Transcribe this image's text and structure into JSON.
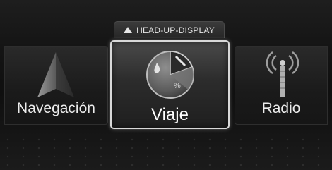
{
  "hud": {
    "label": "HEAD-UP-DISPLAY",
    "icon": "triangle-up-icon"
  },
  "menu": {
    "items": [
      {
        "label": "Navegación",
        "icon": "navigation-arrow-icon",
        "selected": false
      },
      {
        "label": "Viaje",
        "icon": "trip-gauge-icon",
        "selected": true
      },
      {
        "label": "Radio",
        "icon": "radio-antenna-icon",
        "selected": false
      }
    ]
  },
  "colors": {
    "text": "#ececec",
    "selected_border": "#d8d8d8",
    "background": "#111111"
  }
}
